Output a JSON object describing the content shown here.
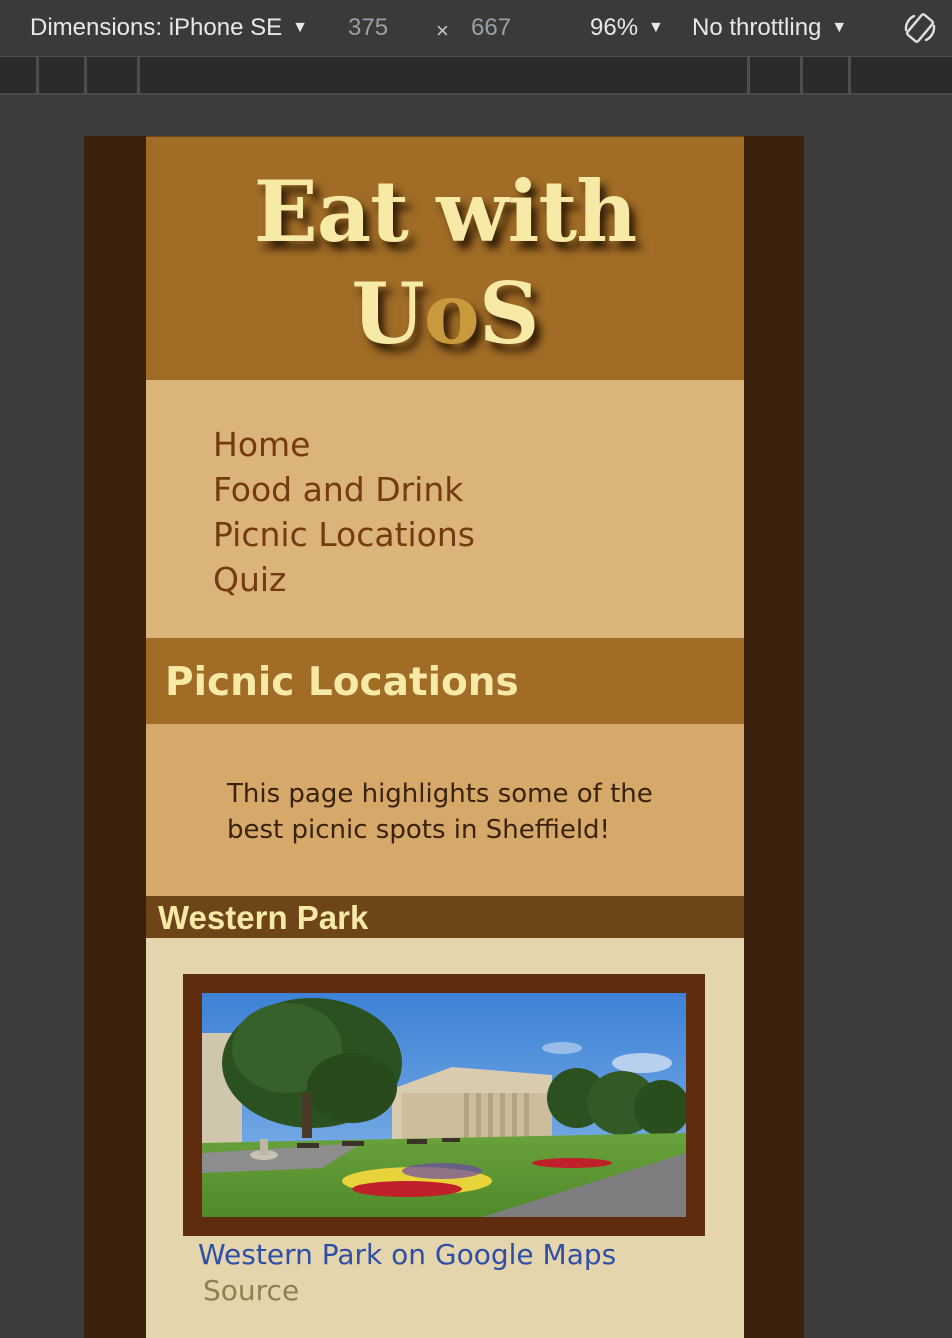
{
  "devtools": {
    "dimensions_label": "Dimensions: iPhone SE",
    "width": "375",
    "times": "×",
    "height": "667",
    "zoom": "96%",
    "throttling": "No throttling",
    "icons": [
      "chevron-down-icon",
      "rotate-icon"
    ]
  },
  "site": {
    "title_line1": "Eat with",
    "title_line2_a": "U",
    "title_line2_b": "o",
    "title_line2_c": "S"
  },
  "nav": {
    "items": [
      {
        "label": "Home"
      },
      {
        "label": "Food and Drink"
      },
      {
        "label": "Picnic Locations"
      },
      {
        "label": "Quiz"
      }
    ]
  },
  "main": {
    "heading": "Picnic Locations",
    "intro": "This page highlights some of the best picnic spots in Sheffield!"
  },
  "sections": [
    {
      "title": "Western Park",
      "map_link": "Western Park on Google Maps",
      "source": "Source"
    }
  ],
  "colors": {
    "header": "#a06c26",
    "title_text": "#f7eaa7",
    "nav_bg": "#dbb479",
    "nav_text": "#763a11",
    "link": "#2f4fa6"
  }
}
